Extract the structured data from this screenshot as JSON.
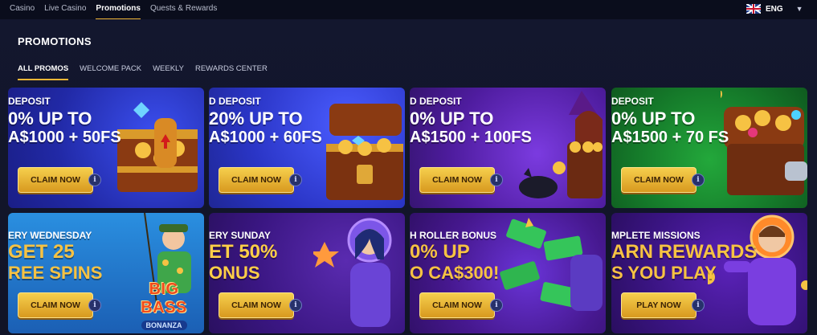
{
  "topnav": {
    "items": [
      "Casino",
      "Live Casino",
      "Promotions",
      "Quests & Rewards"
    ],
    "active": "Promotions",
    "language": "ENG",
    "flag_icon": "uk-flag-icon",
    "accent_color": "#f0b636"
  },
  "page": {
    "title": "PROMOTIONS",
    "tabs": [
      "ALL PROMOS",
      "WELCOME PACK",
      "WEEKLY",
      "REWARDS CENTER"
    ],
    "active_tab": "ALL PROMOS"
  },
  "cards": [
    {
      "line1": "DEPOSIT",
      "line2": "0% UP TO",
      "line3": "A$1000 + 50FS",
      "button": "CLAIM NOW",
      "background": "#2333b8"
    },
    {
      "line1": "D DEPOSIT",
      "line2": "20% UP TO",
      "line3": "A$1000 + 60FS",
      "button": "CLAIM NOW",
      "background": "#2f3ed0"
    },
    {
      "line1": "D DEPOSIT",
      "line2": "0% UP TO",
      "line3": "A$1500 + 100FS",
      "button": "CLAIM NOW",
      "background": "#5a1fa5"
    },
    {
      "line1": "DEPOSIT",
      "line2": "0% UP TO",
      "line3": "A$1500 + 70 FS",
      "button": "CLAIM NOW",
      "background": "#167a2a"
    },
    {
      "line1": "ERY WEDNESDAY",
      "line2": "GET 25",
      "line3": "REE SPINS",
      "button": "CLAIM NOW",
      "background": "#1d7fd0",
      "logo_line1": "BIG BASS",
      "logo_line2": "BONANZA"
    },
    {
      "line1": "ERY SUNDAY",
      "line2": "ET 50%",
      "line3": "ONUS",
      "button": "CLAIM NOW",
      "background": "#3c1680"
    },
    {
      "line1": "H ROLLER BONUS",
      "line2": "0% UP",
      "line3": "O CA$300!",
      "button": "CLAIM NOW",
      "background": "#4a1c95"
    },
    {
      "line1": "MPLETE MISSIONS",
      "line2": "ARN REWARDS",
      "line3": "S YOU PLAY",
      "button": "PLAY NOW",
      "background": "#3a1480"
    }
  ]
}
